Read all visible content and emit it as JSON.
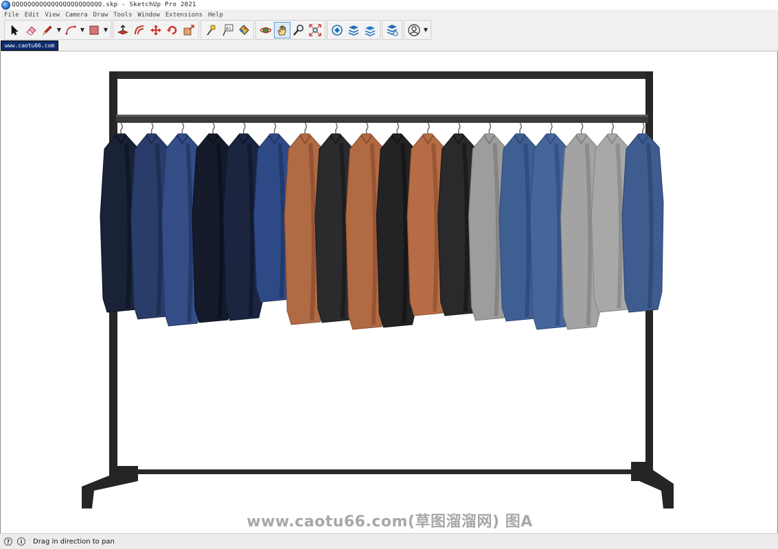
{
  "window": {
    "title": "QQQQQQQQQQQQQQQQQQQQQQQ.skp - SketchUp Pro 2021"
  },
  "menu": {
    "items": [
      "File",
      "Edit",
      "View",
      "Camera",
      "Draw",
      "Tools",
      "Window",
      "Extensions",
      "Help"
    ]
  },
  "toolbar": {
    "tools": [
      {
        "name": "select",
        "icon": "arrow-cursor-icon"
      },
      {
        "name": "eraser",
        "icon": "eraser-icon"
      },
      {
        "name": "line",
        "icon": "pencil-icon"
      },
      {
        "name": "arc",
        "icon": "arc-icon"
      },
      {
        "name": "rectangle",
        "icon": "rectangle-icon"
      },
      {
        "name": "push-pull",
        "icon": "push-pull-icon"
      },
      {
        "name": "offset",
        "icon": "offset-icon"
      },
      {
        "name": "move",
        "icon": "move-icon"
      },
      {
        "name": "rotate",
        "icon": "rotate-icon"
      },
      {
        "name": "scale",
        "icon": "scale-icon"
      },
      {
        "name": "tape-measure",
        "icon": "tape-measure-icon"
      },
      {
        "name": "text",
        "icon": "text-icon"
      },
      {
        "name": "paint-bucket",
        "icon": "paint-bucket-icon"
      },
      {
        "name": "orbit",
        "icon": "orbit-icon"
      },
      {
        "name": "pan",
        "icon": "hand-pan-icon",
        "active": true
      },
      {
        "name": "zoom",
        "icon": "magnifier-icon"
      },
      {
        "name": "zoom-extents",
        "icon": "zoom-extents-icon"
      },
      {
        "name": "3d-warehouse",
        "icon": "warehouse-icon"
      },
      {
        "name": "extension-warehouse",
        "icon": "extension-warehouse-icon"
      },
      {
        "name": "layout",
        "icon": "layout-icon"
      },
      {
        "name": "extension-manager",
        "icon": "extension-manager-icon"
      },
      {
        "name": "account",
        "icon": "user-account-icon"
      }
    ]
  },
  "scene_tabs": [
    "www.caotu66.com"
  ],
  "viewport": {
    "model": "clothes-rack",
    "garments": [
      {
        "color": "#1a2238",
        "shade": "#0d1322"
      },
      {
        "color": "#2a3d6a",
        "shade": "#1a2849"
      },
      {
        "color": "#344d86",
        "shade": "#1f3160"
      },
      {
        "color": "#151b2b",
        "shade": "#0a0f1a"
      },
      {
        "color": "#1b2540",
        "shade": "#0f1529"
      },
      {
        "color": "#2e4a86",
        "shade": "#1d3364"
      },
      {
        "color": "#b06a44",
        "shade": "#8a4d2e"
      },
      {
        "color": "#2b2b2e",
        "shade": "#18181a"
      },
      {
        "color": "#b26a43",
        "shade": "#8b4d2d"
      },
      {
        "color": "#232326",
        "shade": "#121214"
      },
      {
        "color": "#b66c44",
        "shade": "#8d4f2f"
      },
      {
        "color": "#2a2a2d",
        "shade": "#161618"
      },
      {
        "color": "#9d9d9d",
        "shade": "#7b7b7b"
      },
      {
        "color": "#3f5f93",
        "shade": "#2c4674"
      },
      {
        "color": "#46659b",
        "shade": "#304c7a"
      },
      {
        "color": "#a3a3a3",
        "shade": "#808080"
      },
      {
        "color": "#a8a8a8",
        "shade": "#858585"
      },
      {
        "color": "#3e5c8f",
        "shade": "#2b446f"
      }
    ]
  },
  "watermark": "www.caotu66.com(草图溜溜网) 图A",
  "status": {
    "text": "Drag in direction to pan",
    "icons": [
      "question-icon",
      "info-icon"
    ]
  }
}
